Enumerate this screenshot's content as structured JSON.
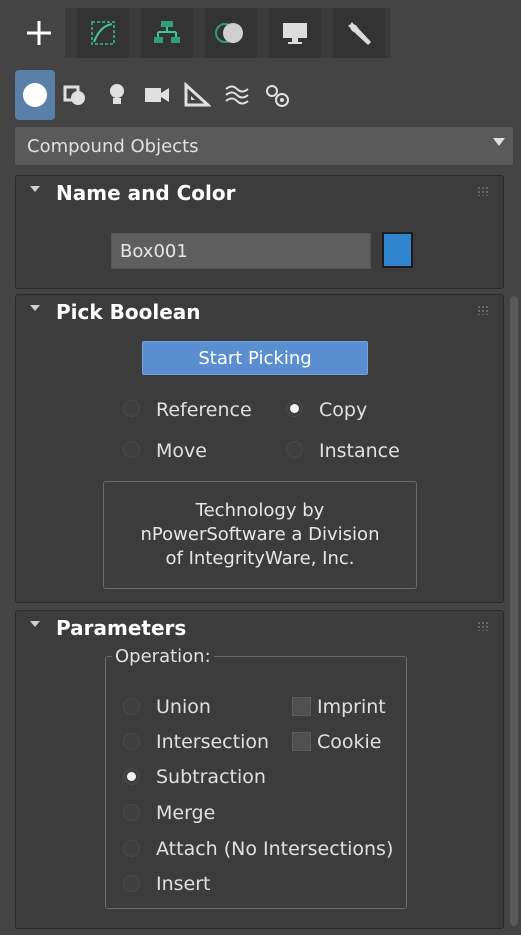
{
  "tabs": [
    {
      "name": "create",
      "icon": "plus-icon",
      "active": true
    },
    {
      "name": "modify",
      "icon": "modify-curve-icon",
      "active": false
    },
    {
      "name": "hierarchy",
      "icon": "hierarchy-icon",
      "active": false
    },
    {
      "name": "motion",
      "icon": "motion-icon",
      "active": false
    },
    {
      "name": "display",
      "icon": "monitor-icon",
      "active": false
    },
    {
      "name": "utilities",
      "icon": "wrench-icon",
      "active": false
    }
  ],
  "categories": [
    {
      "name": "geometry",
      "icon": "sphere-icon",
      "active": true
    },
    {
      "name": "shapes",
      "icon": "shapes-icon"
    },
    {
      "name": "lights",
      "icon": "light-bulb-icon"
    },
    {
      "name": "cameras",
      "icon": "camera-icon"
    },
    {
      "name": "helpers",
      "icon": "helper-ruler-icon"
    },
    {
      "name": "space-warps",
      "icon": "space-warp-icon"
    },
    {
      "name": "systems",
      "icon": "gears-icon"
    }
  ],
  "dropdown": {
    "value": "Compound Objects"
  },
  "name_color": {
    "title": "Name and Color",
    "name_value": "Box001",
    "color": "#2f84cd"
  },
  "pick_boolean": {
    "title": "Pick Boolean",
    "start_button": "Start Picking",
    "options": [
      {
        "label": "Reference",
        "selected": false
      },
      {
        "label": "Copy",
        "selected": true
      },
      {
        "label": "Move",
        "selected": false
      },
      {
        "label": "Instance",
        "selected": false
      }
    ],
    "tech_lines": [
      "Technology by",
      "nPowerSoftware a Division",
      "of IntegrityWare, Inc."
    ]
  },
  "parameters": {
    "title": "Parameters",
    "group_label": "Operation:",
    "operations": [
      {
        "label": "Union",
        "selected": false
      },
      {
        "label": "Intersection",
        "selected": false
      },
      {
        "label": "Subtraction",
        "selected": true
      },
      {
        "label": "Merge",
        "selected": false
      },
      {
        "label": "Attach (No Intersections)",
        "selected": false
      },
      {
        "label": "Insert",
        "selected": false
      }
    ],
    "checks": [
      {
        "label": "Imprint",
        "checked": false
      },
      {
        "label": "Cookie",
        "checked": false
      }
    ]
  },
  "colors": {
    "accent": "#5a8ed1",
    "panel": "#3c3c3c",
    "background": "#444444"
  }
}
